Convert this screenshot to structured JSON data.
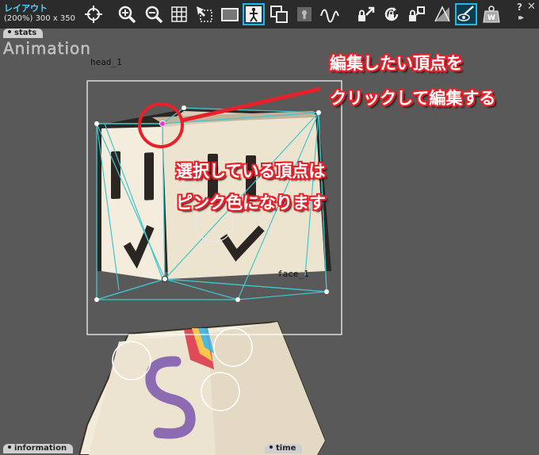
{
  "window": {
    "title": "レイアウト",
    "size_info": "(200%) 300 x 350"
  },
  "toolbar": {
    "items": [
      {
        "name": "move-tool",
        "icon": "crosshair-icon"
      },
      {
        "name": "zoom-in",
        "icon": "zoom-in-icon"
      },
      {
        "name": "zoom-out",
        "icon": "zoom-out-icon"
      },
      {
        "name": "grid",
        "icon": "grid-icon"
      },
      {
        "name": "select-area",
        "icon": "select-area-icon"
      },
      {
        "name": "frame",
        "icon": "frame-icon"
      },
      {
        "name": "skeleton",
        "icon": "stick-figure-icon",
        "active": true
      },
      {
        "name": "overlap",
        "icon": "layers-icon"
      },
      {
        "name": "lock-part",
        "icon": "keyhole-icon"
      },
      {
        "name": "curve",
        "icon": "wave-icon"
      },
      {
        "name": "move-lock",
        "icon": "move-lock-icon"
      },
      {
        "name": "rotate-lock",
        "icon": "rotate-lock-icon"
      },
      {
        "name": "scale-lock",
        "icon": "scale-lock-icon"
      },
      {
        "name": "texture",
        "icon": "texture-icon"
      },
      {
        "name": "view-deform",
        "icon": "eye-brush-icon",
        "active": true
      },
      {
        "name": "knife",
        "icon": "knife-icon"
      },
      {
        "name": "weight",
        "icon": "weight-icon"
      }
    ],
    "help_label": "?",
    "close_label": "✕",
    "forward_label": "▸▸"
  },
  "tabs": {
    "stats": "stats",
    "information": "information",
    "time": "time"
  },
  "mode_title": "Animation",
  "labels": {
    "head": "head_1",
    "face": "face_1"
  },
  "annotations": {
    "top_line1": "編集したい頂点を",
    "top_line2": "クリックして編集する",
    "mid_line1": "選択している頂点は",
    "mid_line2": "ピンク色になります"
  },
  "colors": {
    "accent": "#23b7e5",
    "selected_vertex": "#ff2bd6",
    "mesh": "#3fc6cc",
    "annotation": "#e8202a"
  }
}
